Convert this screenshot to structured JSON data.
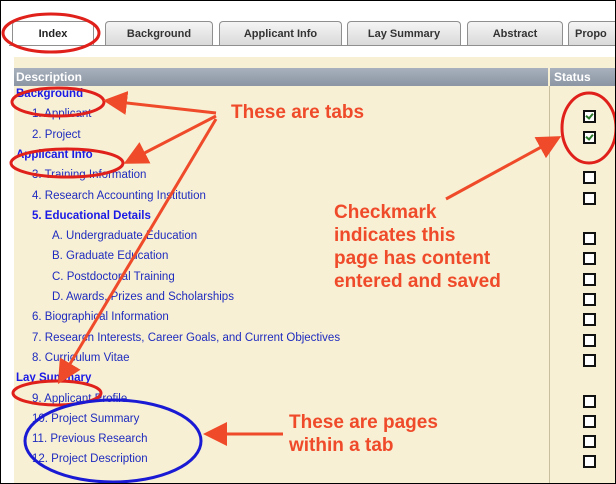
{
  "tabs": [
    "Index",
    "Background",
    "Applicant Info",
    "Lay Summary",
    "Abstract",
    "Propo"
  ],
  "table": {
    "col_description": "Description",
    "col_status": "Status"
  },
  "rows": [
    {
      "label": "Background",
      "kind": "section",
      "checked": null
    },
    {
      "label": "1. Applicant",
      "kind": "item",
      "indent": 2,
      "checked": true
    },
    {
      "label": "2. Project",
      "kind": "item",
      "indent": 2,
      "checked": true
    },
    {
      "label": "Applicant Info",
      "kind": "section",
      "checked": null
    },
    {
      "label": "3. Training Information",
      "kind": "item",
      "indent": 2,
      "checked": false
    },
    {
      "label": "4. Research Accounting Institution",
      "kind": "item",
      "indent": 2,
      "checked": false
    },
    {
      "label": "5. Educational Details",
      "kind": "bold",
      "indent": 2,
      "checked": null
    },
    {
      "label": "A. Undergraduate Education",
      "kind": "item",
      "indent": 3,
      "checked": false
    },
    {
      "label": "B. Graduate Education",
      "kind": "item",
      "indent": 3,
      "checked": false
    },
    {
      "label": "C. Postdoctoral Training",
      "kind": "item",
      "indent": 3,
      "checked": false
    },
    {
      "label": "D. Awards, Prizes and Scholarships",
      "kind": "item",
      "indent": 3,
      "checked": false
    },
    {
      "label": "6. Biographical Information",
      "kind": "item",
      "indent": 2,
      "checked": false
    },
    {
      "label": "7. Research Interests, Career Goals, and Current Objectives",
      "kind": "item",
      "indent": 2,
      "checked": false
    },
    {
      "label": "8. Curriculum Vitae",
      "kind": "item",
      "indent": 2,
      "checked": false
    },
    {
      "label": "Lay Summary",
      "kind": "section",
      "checked": null
    },
    {
      "label": "9. Applicant Profile",
      "kind": "item",
      "indent": 2,
      "checked": false
    },
    {
      "label": "10. Project Summary",
      "kind": "item",
      "indent": 2,
      "checked": false
    },
    {
      "label": "11. Previous Research",
      "kind": "item",
      "indent": 2,
      "checked": false
    },
    {
      "label": "12. Project Description",
      "kind": "item",
      "indent": 2,
      "checked": false
    }
  ],
  "annotations": {
    "tabs_note": "These are tabs",
    "checkmark_note": [
      "Checkmark",
      "indicates this",
      "page has content",
      "entered and saved"
    ],
    "pages_note": [
      "These are pages",
      "within a tab"
    ]
  },
  "colors": {
    "annotation": "#ef4a2a",
    "link": "#1f2bbf",
    "panel_bg": "#f7f0d4"
  }
}
